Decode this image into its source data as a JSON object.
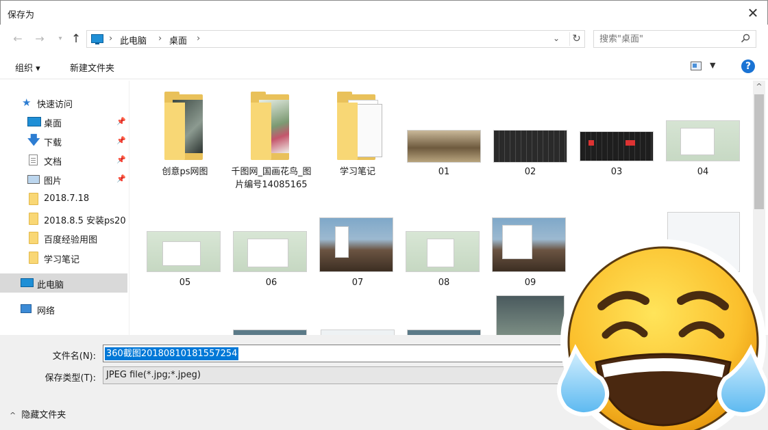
{
  "window": {
    "title": "保存为",
    "close_glyph": "✕"
  },
  "address_bar": {
    "crumbs": [
      "此电脑",
      "桌面"
    ],
    "separator": "›"
  },
  "search": {
    "placeholder": "搜索\"桌面\""
  },
  "toolbar": {
    "organize": "组织 ▾",
    "new_folder": "新建文件夹",
    "help": "?"
  },
  "sidebar": {
    "items": [
      {
        "label": "快速访问",
        "icon": "star-icon"
      },
      {
        "label": "桌面",
        "icon": "desktop-icon",
        "pinned": true
      },
      {
        "label": "下载",
        "icon": "download-icon",
        "pinned": true
      },
      {
        "label": "文档",
        "icon": "document-icon",
        "pinned": true
      },
      {
        "label": "图片",
        "icon": "pictures-icon",
        "pinned": true
      },
      {
        "label": "2018.7.18",
        "icon": "folder-icon"
      },
      {
        "label": "2018.8.5 安装ps20",
        "icon": "folder-icon"
      },
      {
        "label": "百度经验用图",
        "icon": "folder-icon"
      },
      {
        "label": "学习笔记",
        "icon": "folder-icon"
      },
      {
        "label": "此电脑",
        "icon": "this-pc-icon",
        "selected": true
      },
      {
        "label": "网络",
        "icon": "network-icon"
      }
    ]
  },
  "files": [
    {
      "name": "创意ps网图",
      "type": "folder"
    },
    {
      "name": "千图网_国画花鸟_图片编号14085165",
      "type": "folder"
    },
    {
      "name": "学习笔记",
      "type": "folder"
    },
    {
      "name": "01",
      "type": "image"
    },
    {
      "name": "02",
      "type": "image"
    },
    {
      "name": "03",
      "type": "image"
    },
    {
      "name": "04",
      "type": "image"
    },
    {
      "name": "05",
      "type": "image"
    },
    {
      "name": "06",
      "type": "image"
    },
    {
      "name": "07",
      "type": "image"
    },
    {
      "name": "08",
      "type": "image"
    },
    {
      "name": "09",
      "type": "image"
    }
  ],
  "form": {
    "filename_label": "文件名(N):",
    "filename_value": "360截图20180810181557254",
    "filetype_label": "保存类型(T):",
    "filetype_value": "JPEG file(*.jpg;*.jpeg)",
    "hide_folders": "隐藏文件夹"
  },
  "colors": {
    "accent": "#0078d7",
    "folder": "#f8d775",
    "selection": "#d9d9d9"
  }
}
